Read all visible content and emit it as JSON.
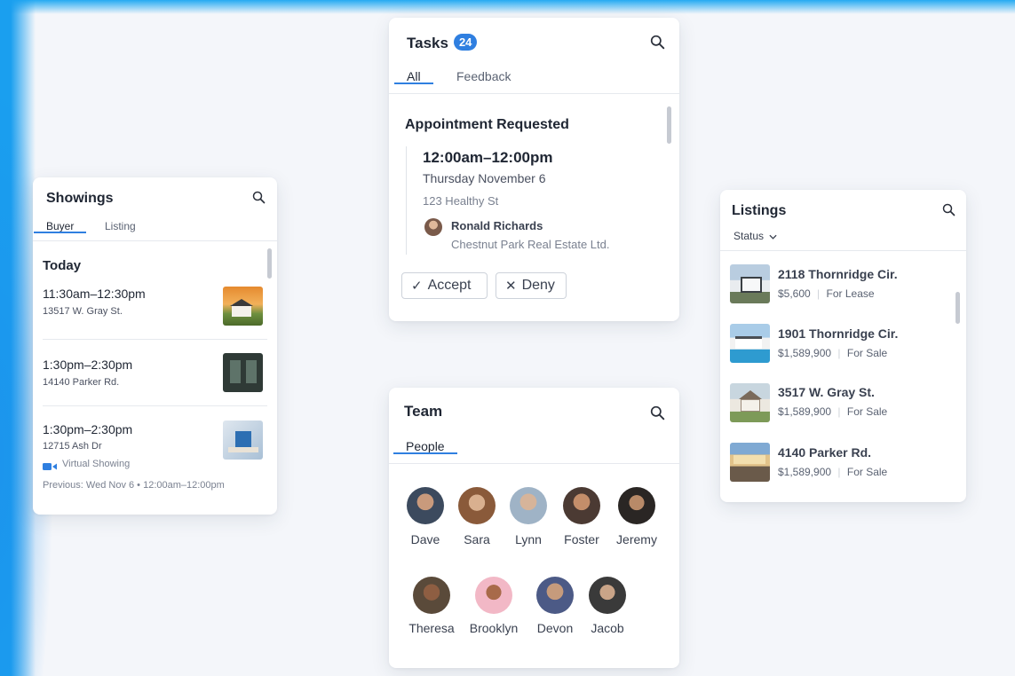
{
  "showings": {
    "title": "Showings",
    "tabs": [
      "Buyer",
      "Listing"
    ],
    "section": "Today",
    "items": [
      {
        "time": "11:30am–12:30pm",
        "address": "13517 W. Gray St."
      },
      {
        "time": "1:30pm–2:30pm",
        "address": "14140 Parker Rd."
      },
      {
        "time": "1:30pm–2:30pm",
        "address": "12715 Ash Dr",
        "tag": "Virtual Showing"
      }
    ],
    "previous": "Previous: Wed Nov 6 • 12:00am–12:00pm"
  },
  "tasks": {
    "title": "Tasks",
    "count": "24",
    "tabs": [
      "All",
      "Feedback"
    ],
    "heading": "Appointment Requested",
    "time": "12:00am–12:00pm",
    "date": "Thursday November 6",
    "address": "123 Healthy St",
    "person_name": "Ronald Richards",
    "company": "Chestnut Park Real Estate Ltd.",
    "accept_label": "Accept",
    "deny_label": "Deny"
  },
  "team": {
    "title": "Team",
    "tab": "People",
    "people": [
      "Dave",
      "Sara",
      "Lynn",
      "Foster",
      "Jeremy",
      "Theresa",
      "Brooklyn",
      "Devon",
      "Jacob"
    ]
  },
  "listings": {
    "title": "Listings",
    "filter": "Status",
    "items": [
      {
        "address": "2118 Thornridge Cir.",
        "price": "$5,600",
        "status": "For Lease"
      },
      {
        "address": "1901 Thornridge Cir.",
        "price": "$1,589,900",
        "status": "For Sale"
      },
      {
        "address": "3517 W. Gray St.",
        "price": "$1,589,900",
        "status": "For Sale"
      },
      {
        "address": "4140 Parker Rd.",
        "price": "$1,589,900",
        "status": "For Sale"
      }
    ]
  },
  "colors": {
    "accent": "#2f7fe0",
    "background_edge": "#1a9fef"
  }
}
